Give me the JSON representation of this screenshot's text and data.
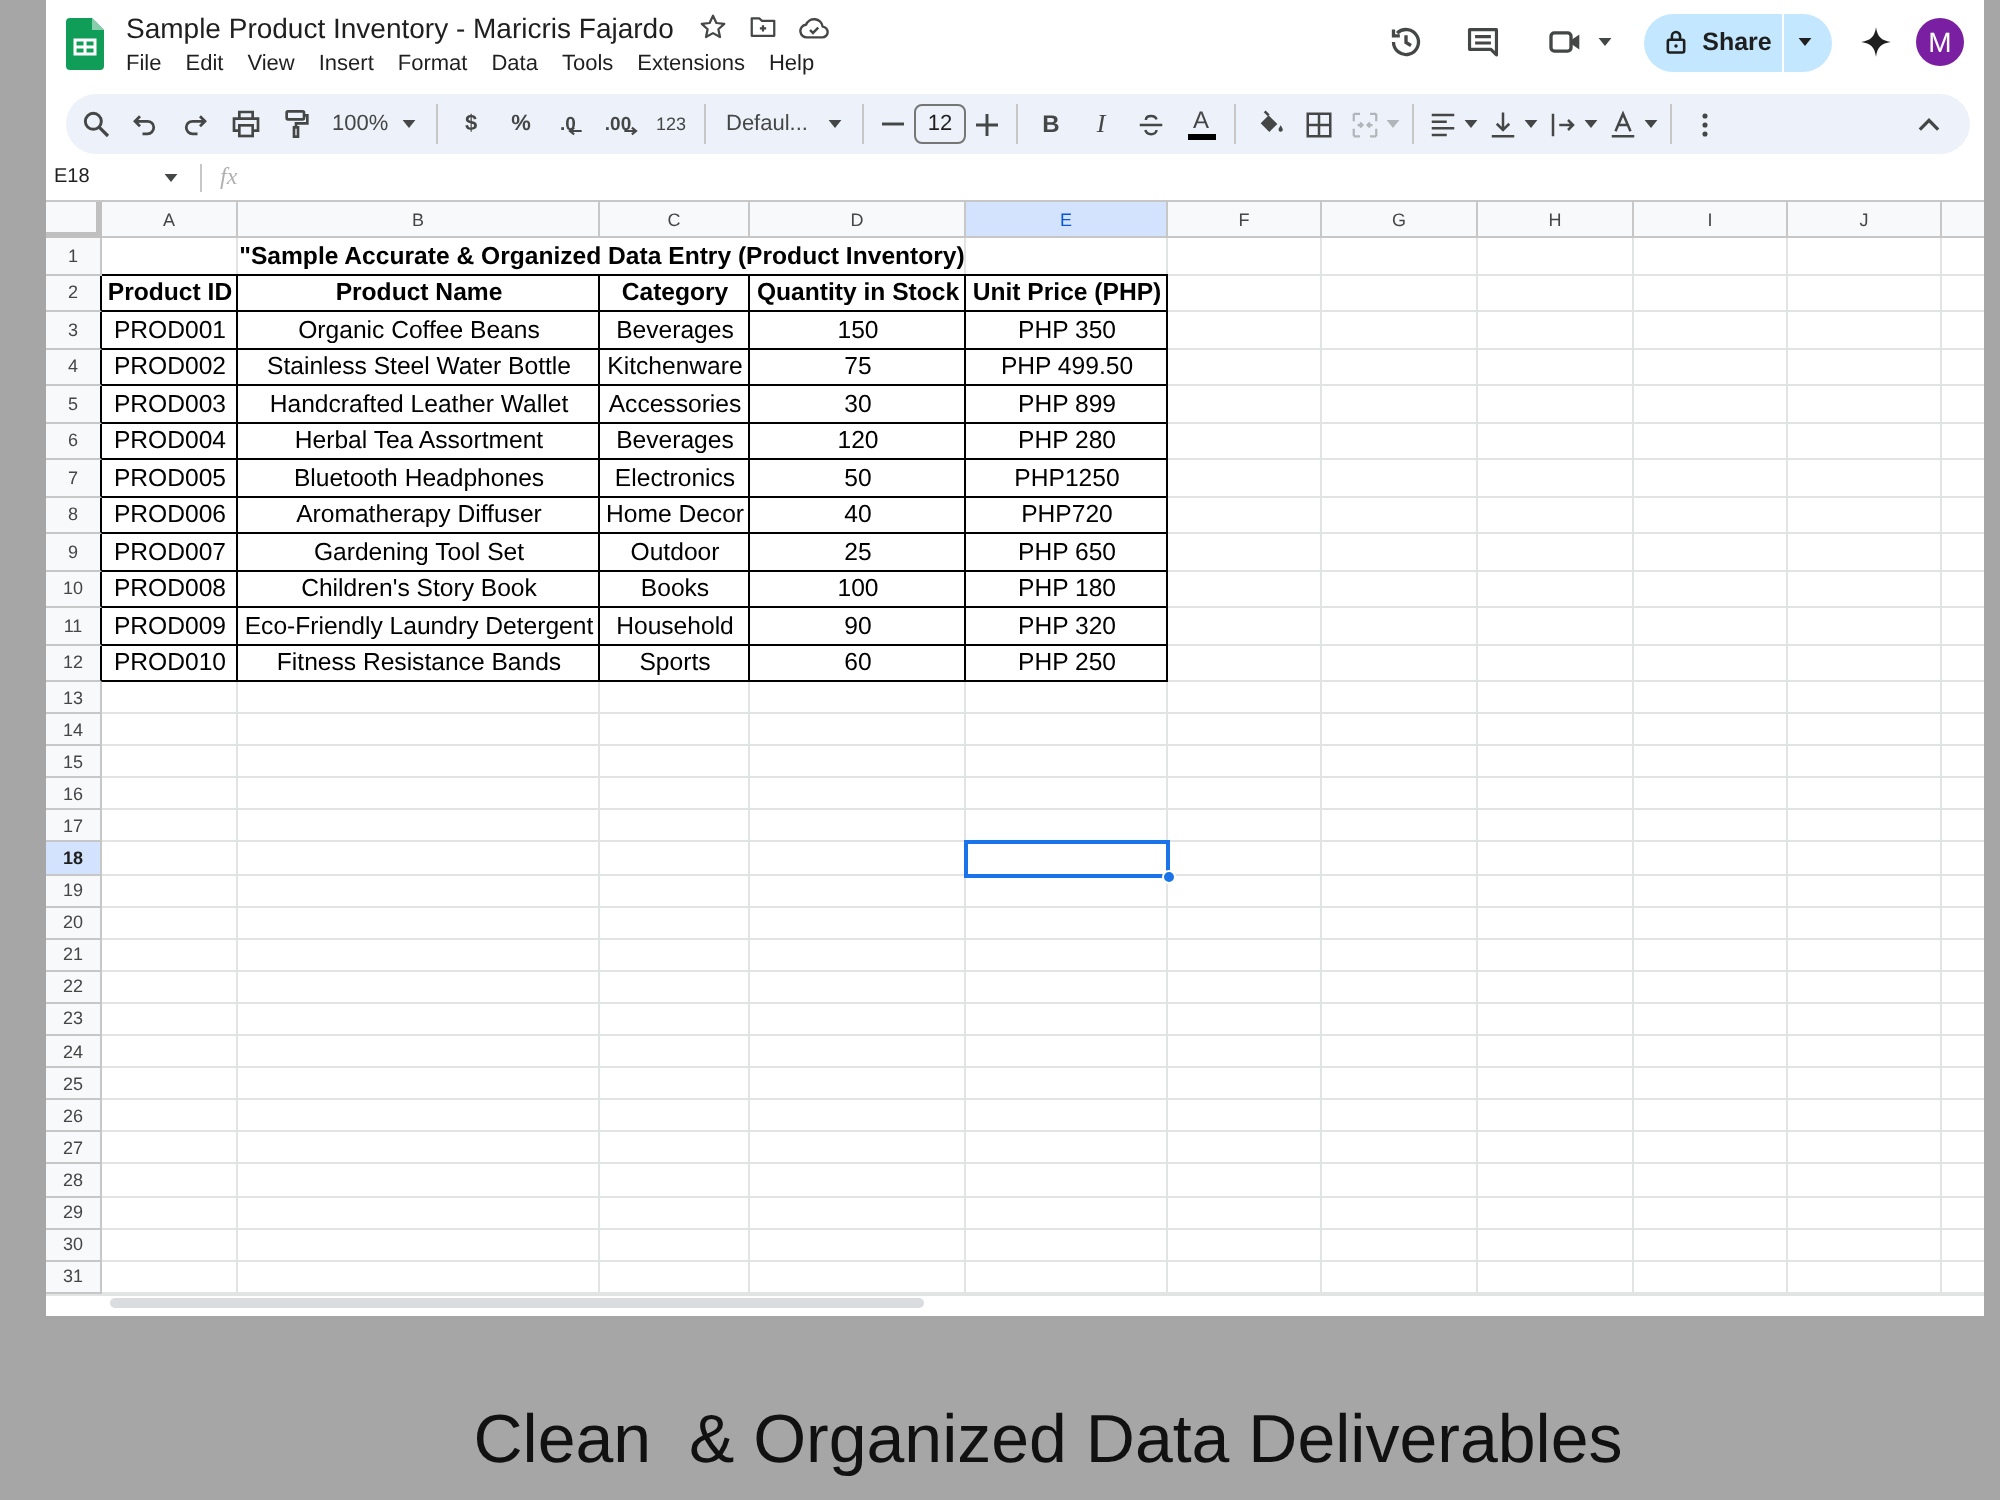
{
  "document": {
    "title": "Sample Product Inventory - Maricris Fajardo",
    "menu": [
      "File",
      "Edit",
      "View",
      "Insert",
      "Format",
      "Data",
      "Tools",
      "Extensions",
      "Help"
    ]
  },
  "account": {
    "share_label": "Share",
    "avatar_initial": "M"
  },
  "toolbar": {
    "zoom": "100%",
    "currency": "$",
    "percent": "%",
    "decrease_decimals": ".0",
    "increase_decimals": ".00",
    "number_format": "123",
    "font": "Defaul...",
    "font_size": "12",
    "bold": "B",
    "italic": "I",
    "text_color": "A",
    "merge": {
      "disabled": true
    }
  },
  "formula_bar": {
    "cell_ref": "E18",
    "fx_label": "fx"
  },
  "sheet": {
    "columns": [
      {
        "label": "A",
        "selected": false
      },
      {
        "label": "B",
        "selected": false
      },
      {
        "label": "C",
        "selected": false
      },
      {
        "label": "D",
        "selected": false
      },
      {
        "label": "E",
        "selected": true
      },
      {
        "label": "F",
        "selected": false
      },
      {
        "label": "G",
        "selected": false
      },
      {
        "label": "H",
        "selected": false
      },
      {
        "label": "I",
        "selected": false
      },
      {
        "label": "J",
        "selected": false
      }
    ],
    "row_headers": [
      {
        "label": "1",
        "selected": false
      },
      {
        "label": "2",
        "selected": false
      },
      {
        "label": "3",
        "selected": false
      },
      {
        "label": "4",
        "selected": false
      },
      {
        "label": "5",
        "selected": false
      },
      {
        "label": "6",
        "selected": false
      },
      {
        "label": "7",
        "selected": false
      },
      {
        "label": "8",
        "selected": false
      },
      {
        "label": "9",
        "selected": false
      },
      {
        "label": "10",
        "selected": false
      },
      {
        "label": "11",
        "selected": false
      },
      {
        "label": "12",
        "selected": false
      },
      {
        "label": "13",
        "selected": false
      },
      {
        "label": "14",
        "selected": false
      },
      {
        "label": "15",
        "selected": false
      },
      {
        "label": "16",
        "selected": false
      },
      {
        "label": "17",
        "selected": false
      },
      {
        "label": "18",
        "selected": true
      },
      {
        "label": "19",
        "selected": false
      },
      {
        "label": "20",
        "selected": false
      },
      {
        "label": "21",
        "selected": false
      },
      {
        "label": "22",
        "selected": false
      },
      {
        "label": "23",
        "selected": false
      },
      {
        "label": "24",
        "selected": false
      },
      {
        "label": "25",
        "selected": false
      },
      {
        "label": "26",
        "selected": false
      },
      {
        "label": "27",
        "selected": false
      },
      {
        "label": "28",
        "selected": false
      },
      {
        "label": "29",
        "selected": false
      },
      {
        "label": "30",
        "selected": false
      },
      {
        "label": "31",
        "selected": false
      }
    ],
    "title": "\"Sample Accurate & Organized Data Entry (Product Inventory)",
    "table": {
      "columns": [
        "Product ID",
        "Product Name",
        "Category",
        "Quantity in Stock",
        "Unit Price (PHP)"
      ],
      "rows": [
        [
          "PROD001",
          "Organic Coffee Beans",
          "Beverages",
          "150",
          "PHP 350"
        ],
        [
          "PROD002",
          "Stainless Steel Water Bottle",
          "Kitchenware",
          "75",
          "PHP 499.50"
        ],
        [
          "PROD003",
          "Handcrafted Leather Wallet",
          "Accessories",
          "30",
          "PHP 899"
        ],
        [
          "PROD004",
          "Herbal Tea Assortment",
          "Beverages",
          "120",
          "PHP 280"
        ],
        [
          "PROD005",
          "Bluetooth Headphones",
          "Electronics",
          "50",
          "PHP1250"
        ],
        [
          "PROD006",
          "Aromatherapy Diffuser",
          "Home Decor",
          "40",
          "PHP720"
        ],
        [
          "PROD007",
          "Gardening Tool Set",
          "Outdoor",
          "25",
          "PHP 650"
        ],
        [
          "PROD008",
          "Children's Story Book",
          "Books",
          "100",
          "PHP 180"
        ],
        [
          "PROD009",
          "Eco-Friendly Laundry Detergent",
          "Household",
          "90",
          "PHP 320"
        ],
        [
          "PROD010",
          "Fitness Resistance Bands",
          "Sports",
          "60",
          "PHP 250"
        ]
      ]
    }
  },
  "caption": "Clean  & Organized Data Deliverables"
}
